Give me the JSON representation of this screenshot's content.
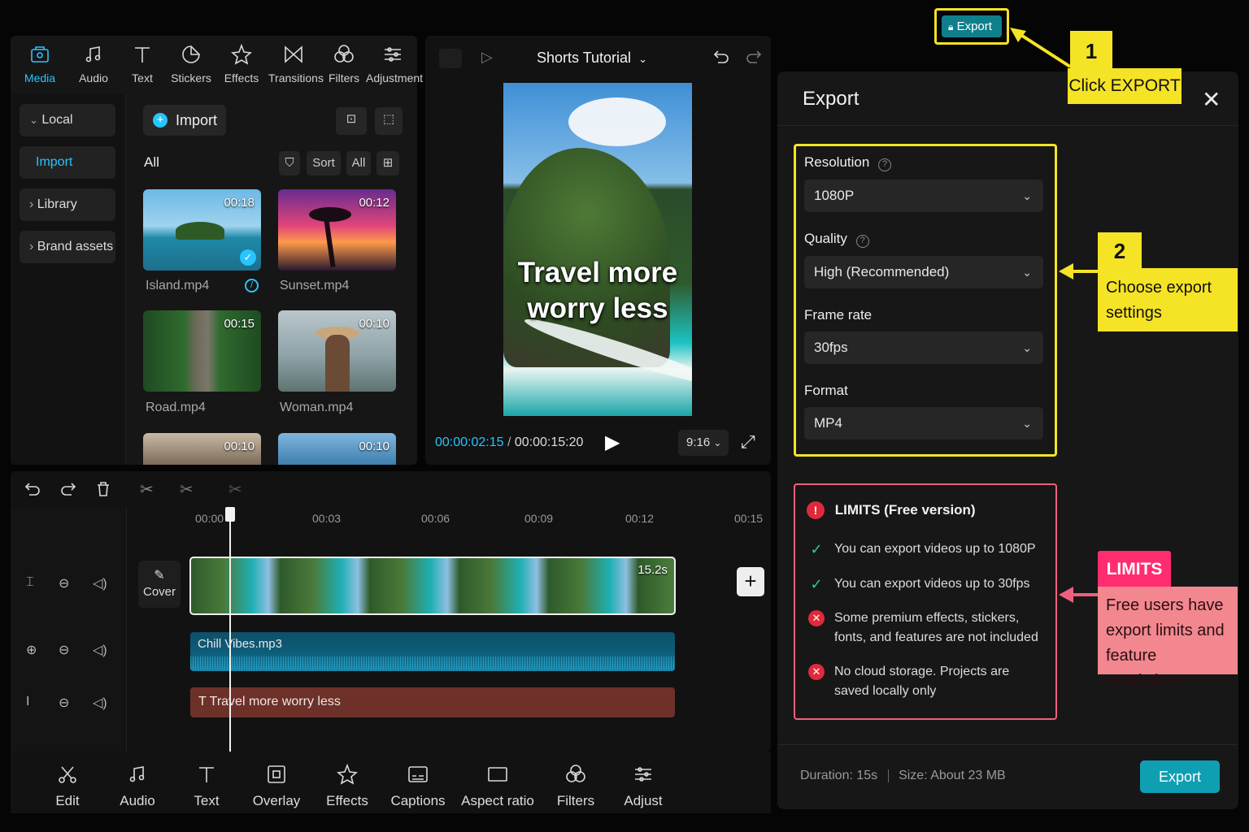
{
  "toolbar": {
    "items": [
      {
        "label": "Media",
        "icon": "media-icon"
      },
      {
        "label": "Audio",
        "icon": "music-note-icon"
      },
      {
        "label": "Text",
        "icon": "text-icon"
      },
      {
        "label": "Stickers",
        "icon": "sticker-icon"
      },
      {
        "label": "Effects",
        "icon": "sparkle-icon"
      },
      {
        "label": "Transitions",
        "icon": "transition-icon"
      },
      {
        "label": "Filters",
        "icon": "filters-icon"
      },
      {
        "label": "Adjustment",
        "icon": "sliders-icon"
      }
    ]
  },
  "sidebar": {
    "items": [
      {
        "label": "Local",
        "prefix": "⌄"
      },
      {
        "label": "Import"
      },
      {
        "label": "Library",
        "prefix": "›"
      },
      {
        "label": "Brand assets",
        "prefix": "›"
      }
    ]
  },
  "media": {
    "import_label": "Import",
    "filter_all": "All",
    "sort_label": "Sort",
    "all_label": "All",
    "items": [
      {
        "name": "Island.mp4",
        "duration": "00:18"
      },
      {
        "name": "Sunset.mp4",
        "duration": "00:12"
      },
      {
        "name": "Road.mp4",
        "duration": "00:15"
      },
      {
        "name": "Woman.mp4",
        "duration": "00:10"
      },
      {
        "name": "",
        "duration": "00:10"
      },
      {
        "name": "",
        "duration": "00:10"
      }
    ]
  },
  "preview": {
    "project_title": "Shorts Tutorial",
    "caption_line1": "Travel more",
    "caption_line2": "worry less",
    "current_time": "00:00:02:15",
    "separator": "/",
    "total_time": "00:00:15:20",
    "aspect": "9:16"
  },
  "export_top_button": "Export",
  "export_panel": {
    "title": "Export",
    "resolution_label": "Resolution",
    "resolution_value": "1080P",
    "quality_label": "Quality",
    "quality_value": "High (Recommended)",
    "framerate_label": "Frame rate",
    "framerate_value": "30fps",
    "format_label": "Format",
    "format_value": "MP4",
    "limits_title": "LIMITS (Free version)",
    "limits": [
      {
        "type": "ok",
        "text": "You can export videos up to 1080P"
      },
      {
        "type": "ok",
        "text": "You can export videos up to 30fps"
      },
      {
        "type": "no",
        "text": "Some premium effects, stickers, fonts, and features are not included"
      },
      {
        "type": "no",
        "text": "No cloud storage. Projects are saved locally only"
      }
    ],
    "duration": "Duration: 15s",
    "size": "Size: About 23 MB",
    "export_button": "Export"
  },
  "callouts": {
    "step1_number": "1",
    "step1_text": "Click EXPORT",
    "step2_number": "2",
    "step2_text": "Choose export settings",
    "limits_tag": "LIMITS",
    "limits_text": "Free users have export limits and feature restrictions."
  },
  "timeline": {
    "ruler": [
      "00:00",
      "00:03",
      "00:06",
      "00:09",
      "00:12",
      "00:15"
    ],
    "cover_label": "Cover",
    "video_clip_length": "15.2s",
    "audio_clip": "Chill Vibes.mp3",
    "text_clip": "T Travel more worry less"
  },
  "bottom_toolbar": {
    "items": [
      {
        "label": "Edit",
        "icon": "scissors-icon"
      },
      {
        "label": "Audio",
        "icon": "music-note-icon"
      },
      {
        "label": "Text",
        "icon": "text-icon"
      },
      {
        "label": "Overlay",
        "icon": "overlay-icon"
      },
      {
        "label": "Effects",
        "icon": "sparkle-icon"
      },
      {
        "label": "Captions",
        "icon": "captions-icon"
      },
      {
        "label": "Aspect ratio",
        "icon": "aspect-ratio-icon"
      },
      {
        "label": "Filters",
        "icon": "filters-icon"
      },
      {
        "label": "Adjust",
        "icon": "sliders-icon"
      }
    ]
  },
  "colors": {
    "accent_cyan": "#27c5ff",
    "export_teal": "#0f9fb3",
    "callout_yellow": "#f5e326",
    "callout_pink": "#ff2d6f",
    "limits_border": "#f0607e"
  }
}
